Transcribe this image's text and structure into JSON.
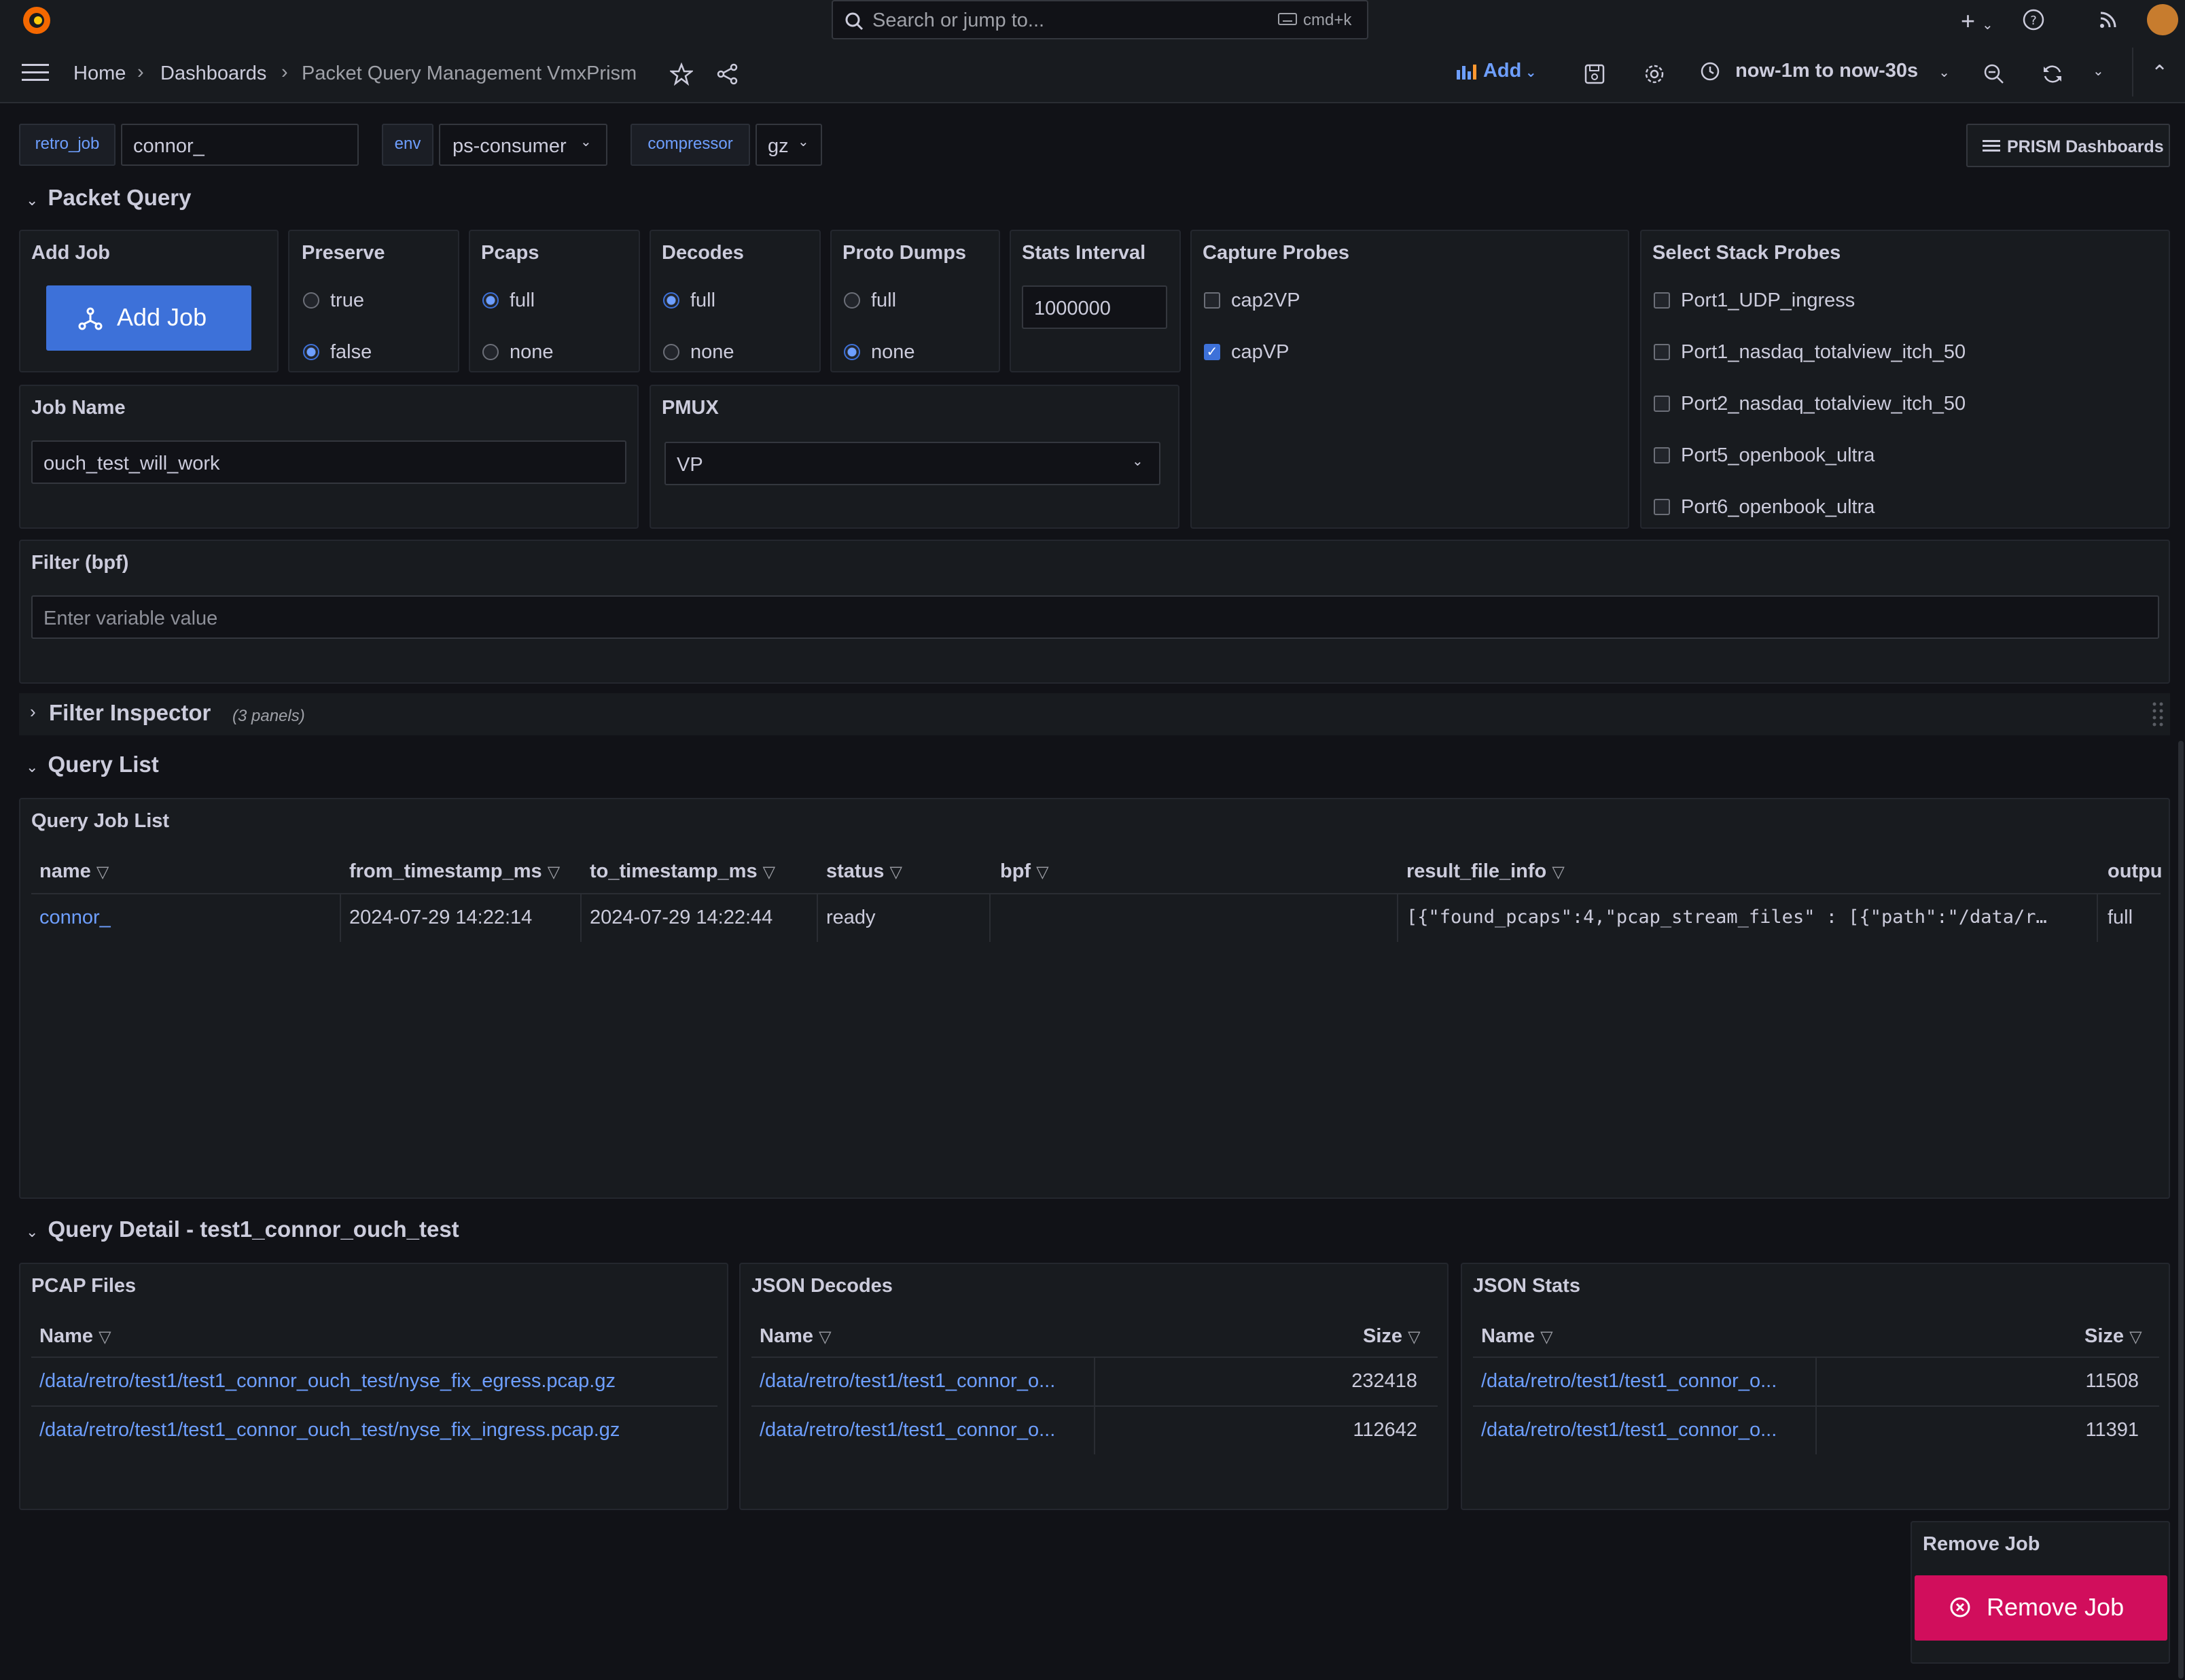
{
  "topbar": {
    "search_placeholder": "Search or jump to...",
    "shortcut": "cmd+k"
  },
  "breadcrumb": [
    "Home",
    "Dashboards",
    "Packet Query Management VmxPrism"
  ],
  "nav": {
    "add_label": "Add",
    "time_range": "now-1m to now-30s"
  },
  "variables": {
    "retro_job_label": "retro_job",
    "retro_job_value": "connor_",
    "env_label": "env",
    "env_value": "ps-consumer",
    "compressor_label": "compressor",
    "compressor_value": "gz",
    "prism_button": "PRISM Dashboards"
  },
  "sections": {
    "packet_query": "Packet Query",
    "filter_inspector": "Filter Inspector",
    "filter_inspector_count": "(3 panels)",
    "query_list": "Query List",
    "query_detail": "Query Detail - test1_connor_ouch_test"
  },
  "packet_query": {
    "add_job_title": "Add Job",
    "add_job_button": "Add Job",
    "preserve_title": "Preserve",
    "preserve_options": [
      "true",
      "false"
    ],
    "pcaps_title": "Pcaps",
    "pcaps_options": [
      "full",
      "none"
    ],
    "decodes_title": "Decodes",
    "decodes_options": [
      "full",
      "none"
    ],
    "proto_dumps_title": "Proto Dumps",
    "proto_dumps_options": [
      "full",
      "none"
    ],
    "stats_interval_title": "Stats Interval",
    "stats_interval_value": "1000000",
    "capture_probes_title": "Capture Probes",
    "capture_probes": [
      "cap2VP",
      "capVP"
    ],
    "stack_probes_title": "Select Stack Probes",
    "stack_probes": [
      "Port1_UDP_ingress",
      "Port1_nasdaq_totalview_itch_50",
      "Port2_nasdaq_totalview_itch_50",
      "Port5_openbook_ultra",
      "Port6_openbook_ultra"
    ],
    "job_name_title": "Job Name",
    "job_name_value": "ouch_test_will_work",
    "pmux_title": "PMUX",
    "pmux_value": "VP",
    "filter_title": "Filter (bpf)",
    "filter_placeholder": "Enter variable value"
  },
  "query_list": {
    "title": "Query Job List",
    "columns": [
      "name",
      "from_timestamp_ms",
      "to_timestamp_ms",
      "status",
      "bpf",
      "result_file_info",
      "outpu"
    ],
    "row": {
      "name": "connor_",
      "from": "2024-07-29 14:22:14",
      "to": "2024-07-29 14:22:44",
      "status": "ready",
      "bpf": "",
      "result": "[{\"found_pcaps\":4,\"pcap_stream_files\" : [{\"path\":\"/data/r…",
      "output": "full"
    }
  },
  "query_detail": {
    "pcap": {
      "title": "PCAP Files",
      "col_name": "Name",
      "rows": [
        "/data/retro/test1/test1_connor_ouch_test/nyse_fix_egress.pcap.gz",
        "/data/retro/test1/test1_connor_ouch_test/nyse_fix_ingress.pcap.gz"
      ]
    },
    "json_decodes": {
      "title": "JSON Decodes",
      "col_name": "Name",
      "col_size": "Size",
      "rows": [
        {
          "name": "/data/retro/test1/test1_connor_o...",
          "size": "232418"
        },
        {
          "name": "/data/retro/test1/test1_connor_o...",
          "size": "112642"
        }
      ]
    },
    "json_stats": {
      "title": "JSON Stats",
      "col_name": "Name",
      "col_size": "Size",
      "rows": [
        {
          "name": "/data/retro/test1/test1_connor_o...",
          "size": "11508"
        },
        {
          "name": "/data/retro/test1/test1_connor_o...",
          "size": "11391"
        }
      ]
    }
  },
  "remove_job": {
    "title": "Remove Job",
    "button": "Remove Job"
  }
}
